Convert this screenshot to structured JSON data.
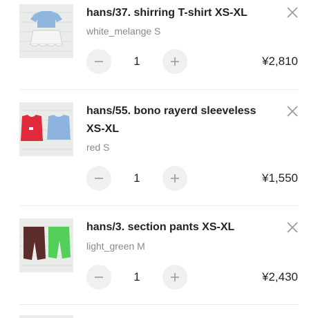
{
  "cart": {
    "items": [
      {
        "title": "hans/37. shirring T-shirt XS-XL",
        "variant": "white_melange S",
        "quantity": "1",
        "price": "¥2,810",
        "thumbnail_icon": "shirt-set-image"
      },
      {
        "title": "hans/55. bono rayerd sleeveless XS-XL",
        "variant": "red S",
        "quantity": "1",
        "price": "¥1,550",
        "thumbnail_icon": "sleeveless-image"
      },
      {
        "title": "hans/3. section pants XS-XL",
        "variant": "light_green M",
        "quantity": "1",
        "price": "¥2,430",
        "thumbnail_icon": "pants-image"
      }
    ]
  },
  "colors": {
    "stepper_bg": "#f0f0f0",
    "icon_gray": "#999999",
    "divider": "#ececec"
  }
}
